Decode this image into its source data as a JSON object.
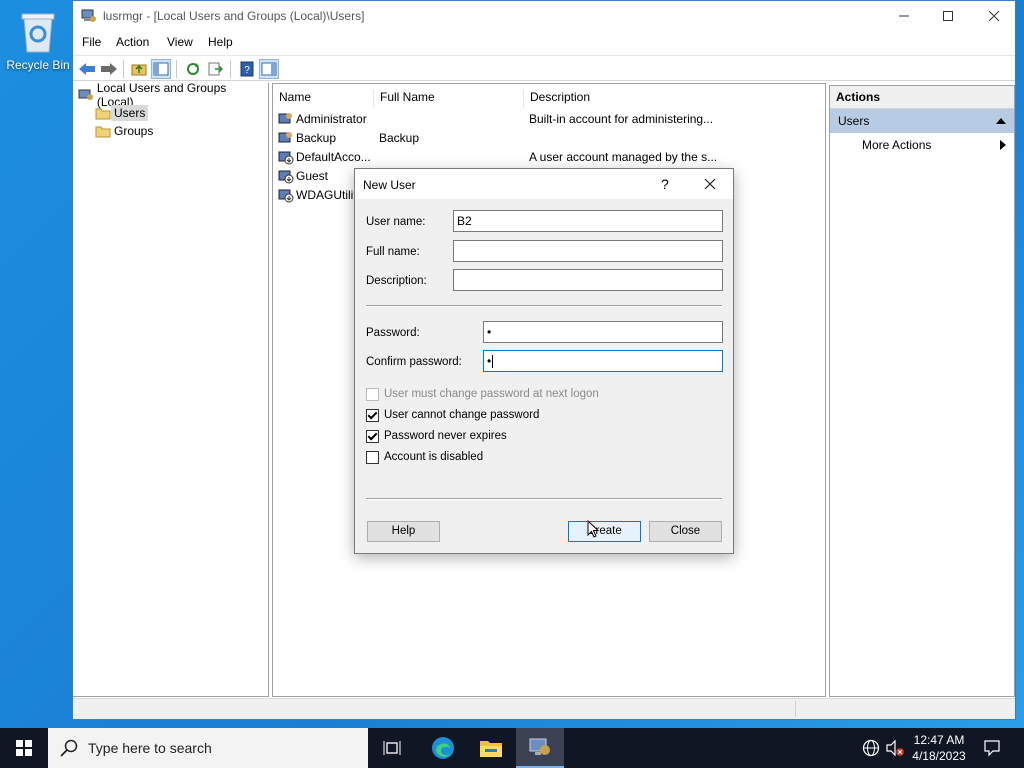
{
  "desktop": {
    "recycle_bin_label": "Recycle Bin"
  },
  "window": {
    "title": "lusrmgr - [Local Users and Groups (Local)\\Users]",
    "menu": [
      "File",
      "Action",
      "View",
      "Help"
    ]
  },
  "tree": {
    "root": "Local Users and Groups (Local)",
    "items": [
      "Users",
      "Groups"
    ],
    "selected": "Users"
  },
  "list": {
    "columns": [
      "Name",
      "Full Name",
      "Description"
    ],
    "rows": [
      {
        "name": "Administrator",
        "full_name": "",
        "description": "Built-in account for administering..."
      },
      {
        "name": "Backup",
        "full_name": "Backup",
        "description": ""
      },
      {
        "name": "DefaultAcco...",
        "full_name": "",
        "description": "A user account managed by the s..."
      },
      {
        "name": "Guest",
        "full_name": "",
        "description": ""
      },
      {
        "name": "WDAGUtilit",
        "full_name": "",
        "description": ""
      }
    ]
  },
  "actions": {
    "header": "Actions",
    "section": "Users",
    "more": "More Actions"
  },
  "dialog": {
    "title": "New User",
    "help_glyph": "?",
    "labels": {
      "username": "User name:",
      "fullname": "Full name:",
      "description": "Description:",
      "password": "Password:",
      "confirm": "Confirm password:"
    },
    "values": {
      "username": "B2",
      "fullname": "",
      "description": "",
      "password": "•",
      "confirm": "•"
    },
    "checkboxes": [
      {
        "label": "User must change password at next logon",
        "checked": false,
        "disabled": true
      },
      {
        "label": "User cannot change password",
        "checked": true,
        "disabled": false
      },
      {
        "label": "Password never expires",
        "checked": true,
        "disabled": false
      },
      {
        "label": "Account is disabled",
        "checked": false,
        "disabled": false
      }
    ],
    "buttons": {
      "help": "Help",
      "create": "Create",
      "close": "Close"
    }
  },
  "taskbar": {
    "search_placeholder": "Type here to search",
    "time": "12:47 AM",
    "date": "4/18/2023"
  }
}
